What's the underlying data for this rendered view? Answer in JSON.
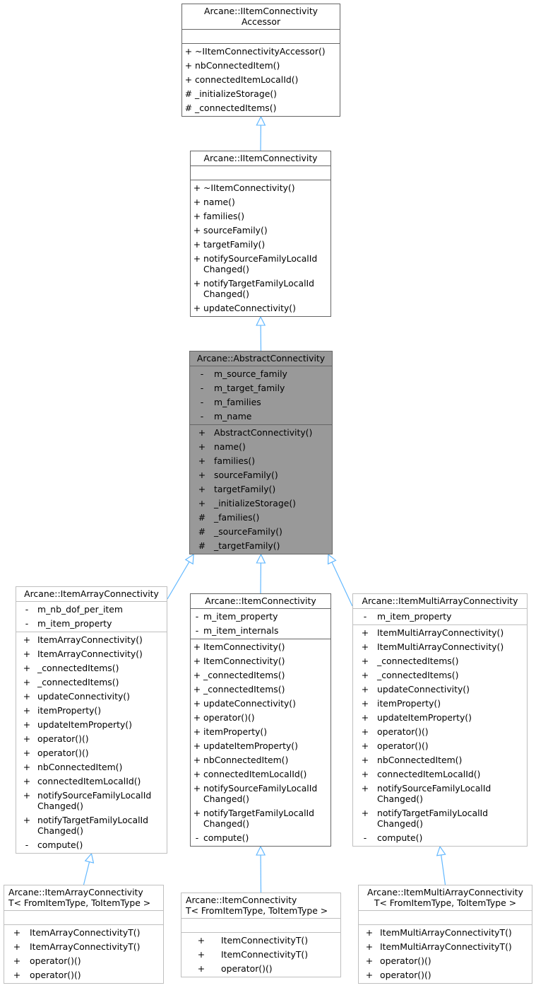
{
  "diagram": {
    "type": "class-inheritance",
    "edge_color": "#63b8ff",
    "focus_fill": "#999999",
    "classes": [
      {
        "id": "accessor",
        "title": "Arcane::IItemConnectivity\nAccessor",
        "attributes": [],
        "methods": [
          {
            "vis": "+",
            "name": "~IItemConnectivityAccessor()"
          },
          {
            "vis": "+",
            "name": "nbConnectedItem()"
          },
          {
            "vis": "+",
            "name": "connectedItemLocalId()"
          },
          {
            "vis": "#",
            "name": "_initializeStorage()"
          },
          {
            "vis": "#",
            "name": "_connectedItems()"
          }
        ]
      },
      {
        "id": "iconnectivity",
        "title": "Arcane::IItemConnectivity",
        "attributes": [],
        "methods": [
          {
            "vis": "+",
            "name": "~IItemConnectivity()"
          },
          {
            "vis": "+",
            "name": "name()"
          },
          {
            "vis": "+",
            "name": "families()"
          },
          {
            "vis": "+",
            "name": "sourceFamily()"
          },
          {
            "vis": "+",
            "name": "targetFamily()"
          },
          {
            "vis": "+",
            "name": "notifySourceFamilyLocalId\nChanged()"
          },
          {
            "vis": "+",
            "name": "notifyTargetFamilyLocalId\nChanged()"
          },
          {
            "vis": "+",
            "name": "updateConnectivity()"
          }
        ]
      },
      {
        "id": "abstract",
        "title": "Arcane::AbstractConnectivity",
        "attributes": [
          {
            "vis": "-",
            "name": "m_source_family"
          },
          {
            "vis": "-",
            "name": "m_target_family"
          },
          {
            "vis": "-",
            "name": "m_families"
          },
          {
            "vis": "-",
            "name": "m_name"
          }
        ],
        "methods": [
          {
            "vis": "+",
            "name": "AbstractConnectivity()"
          },
          {
            "vis": "+",
            "name": "name()"
          },
          {
            "vis": "+",
            "name": "families()"
          },
          {
            "vis": "+",
            "name": "sourceFamily()"
          },
          {
            "vis": "+",
            "name": "targetFamily()"
          },
          {
            "vis": "+",
            "name": "_initializeStorage()"
          },
          {
            "vis": "#",
            "name": "_families()"
          },
          {
            "vis": "#",
            "name": "_sourceFamily()"
          },
          {
            "vis": "#",
            "name": "_targetFamily()"
          }
        ]
      },
      {
        "id": "array",
        "title": "Arcane::ItemArrayConnectivity",
        "attributes": [
          {
            "vis": "-",
            "name": "m_nb_dof_per_item"
          },
          {
            "vis": "-",
            "name": "m_item_property"
          }
        ],
        "methods": [
          {
            "vis": "+",
            "name": "ItemArrayConnectivity()"
          },
          {
            "vis": "+",
            "name": "ItemArrayConnectivity()"
          },
          {
            "vis": "+",
            "name": "_connectedItems()"
          },
          {
            "vis": "+",
            "name": "_connectedItems()"
          },
          {
            "vis": "+",
            "name": "updateConnectivity()"
          },
          {
            "vis": "+",
            "name": "itemProperty()"
          },
          {
            "vis": "+",
            "name": "updateItemProperty()"
          },
          {
            "vis": "+",
            "name": "operator()()"
          },
          {
            "vis": "+",
            "name": "operator()()"
          },
          {
            "vis": "+",
            "name": "nbConnectedItem()"
          },
          {
            "vis": "+",
            "name": "connectedItemLocalId()"
          },
          {
            "vis": "+",
            "name": "notifySourceFamilyLocalId\nChanged()"
          },
          {
            "vis": "+",
            "name": "notifyTargetFamilyLocalId\nChanged()"
          },
          {
            "vis": "-",
            "name": "compute()"
          }
        ]
      },
      {
        "id": "item",
        "title": "Arcane::ItemConnectivity",
        "attributes": [
          {
            "vis": "-",
            "name": "m_item_property"
          },
          {
            "vis": "-",
            "name": "m_item_internals"
          }
        ],
        "methods": [
          {
            "vis": "+",
            "name": "ItemConnectivity()"
          },
          {
            "vis": "+",
            "name": "ItemConnectivity()"
          },
          {
            "vis": "+",
            "name": "_connectedItems()"
          },
          {
            "vis": "+",
            "name": "_connectedItems()"
          },
          {
            "vis": "+",
            "name": "updateConnectivity()"
          },
          {
            "vis": "+",
            "name": "operator()()"
          },
          {
            "vis": "+",
            "name": "itemProperty()"
          },
          {
            "vis": "+",
            "name": "updateItemProperty()"
          },
          {
            "vis": "+",
            "name": "nbConnectedItem()"
          },
          {
            "vis": "+",
            "name": "connectedItemLocalId()"
          },
          {
            "vis": "+",
            "name": "notifySourceFamilyLocalId\nChanged()"
          },
          {
            "vis": "+",
            "name": "notifyTargetFamilyLocalId\nChanged()"
          },
          {
            "vis": "-",
            "name": "compute()"
          }
        ]
      },
      {
        "id": "multi",
        "title": "Arcane::ItemMultiArrayConnectivity",
        "attributes": [
          {
            "vis": "-",
            "name": "m_item_property"
          }
        ],
        "methods": [
          {
            "vis": "+",
            "name": "ItemMultiArrayConnectivity()"
          },
          {
            "vis": "+",
            "name": "ItemMultiArrayConnectivity()"
          },
          {
            "vis": "+",
            "name": "_connectedItems()"
          },
          {
            "vis": "+",
            "name": "_connectedItems()"
          },
          {
            "vis": "+",
            "name": "updateConnectivity()"
          },
          {
            "vis": "+",
            "name": "itemProperty()"
          },
          {
            "vis": "+",
            "name": "updateItemProperty()"
          },
          {
            "vis": "+",
            "name": "operator()()"
          },
          {
            "vis": "+",
            "name": "operator()()"
          },
          {
            "vis": "+",
            "name": "nbConnectedItem()"
          },
          {
            "vis": "+",
            "name": "connectedItemLocalId()"
          },
          {
            "vis": "+",
            "name": "notifySourceFamilyLocalId\nChanged()"
          },
          {
            "vis": "+",
            "name": "notifyTargetFamilyLocalId\nChanged()"
          },
          {
            "vis": "-",
            "name": "compute()"
          }
        ]
      },
      {
        "id": "arrayT",
        "title": "Arcane::ItemArrayConnectivity\nT< FromItemType, ToItemType >",
        "attributes": [],
        "methods": [
          {
            "vis": "+",
            "name": "ItemArrayConnectivityT()"
          },
          {
            "vis": "+",
            "name": "ItemArrayConnectivityT()"
          },
          {
            "vis": "+",
            "name": "operator()()"
          },
          {
            "vis": "+",
            "name": "operator()()"
          }
        ]
      },
      {
        "id": "itemT",
        "title": "Arcane::ItemConnectivity\nT< FromItemType, ToItemType >",
        "attributes": [],
        "methods": [
          {
            "vis": "+",
            "name": "ItemConnectivityT()"
          },
          {
            "vis": "+",
            "name": "ItemConnectivityT()"
          },
          {
            "vis": "+",
            "name": "operator()()"
          }
        ]
      },
      {
        "id": "multiT",
        "title": "Arcane::ItemMultiArrayConnectivity\nT< FromItemType, ToItemType >",
        "attributes": [],
        "methods": [
          {
            "vis": "+",
            "name": "ItemMultiArrayConnectivityT()"
          },
          {
            "vis": "+",
            "name": "ItemMultiArrayConnectivityT()"
          },
          {
            "vis": "+",
            "name": "operator()()"
          },
          {
            "vis": "+",
            "name": "operator()()"
          }
        ]
      }
    ],
    "inheritance": [
      {
        "child": "iconnectivity",
        "parent": "accessor"
      },
      {
        "child": "abstract",
        "parent": "iconnectivity"
      },
      {
        "child": "array",
        "parent": "abstract"
      },
      {
        "child": "item",
        "parent": "abstract"
      },
      {
        "child": "multi",
        "parent": "abstract"
      },
      {
        "child": "arrayT",
        "parent": "array"
      },
      {
        "child": "itemT",
        "parent": "item"
      },
      {
        "child": "multiT",
        "parent": "multi"
      }
    ]
  }
}
